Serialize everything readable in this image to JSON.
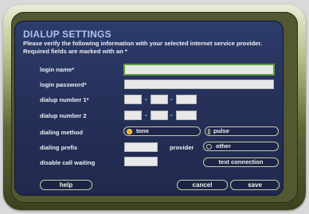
{
  "title": "DIALUP SETTINGS",
  "description": "Please verify the following information with your selected internet service provider.  Required fields are marked with an *",
  "fields": {
    "login_name": {
      "label": "login name*",
      "value": ""
    },
    "login_password": {
      "label": "login password*",
      "value": ""
    },
    "dialup_number_1": {
      "label": "dialup number 1*",
      "parts": [
        "",
        "",
        ""
      ]
    },
    "dialup_number_2": {
      "label": "dialup number 2",
      "parts": [
        "",
        "",
        ""
      ]
    },
    "dialing_method": {
      "label": "dialing method",
      "options": [
        "tone",
        "pulse"
      ],
      "selected": "tone"
    },
    "dialing_prefix": {
      "label": "dialing prefix",
      "value": ""
    },
    "provider": {
      "label": "provider",
      "value": "other"
    },
    "disable_call_waiting": {
      "label": "disable call waiting",
      "value": ""
    }
  },
  "dash": "-",
  "buttons": {
    "test_connection": "test connection",
    "help": "help",
    "cancel": "cancel",
    "save": "save"
  },
  "colors": {
    "title": "#a9c2f0",
    "panel": "#26315a",
    "focus_border": "#5c9e3e",
    "radio_selected": "#f0b018"
  }
}
